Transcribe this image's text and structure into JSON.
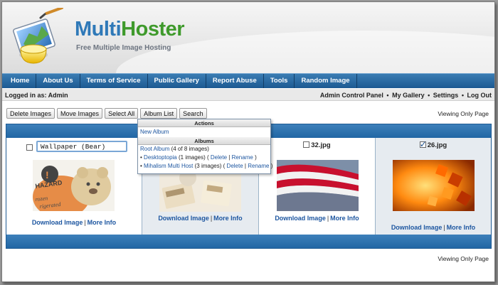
{
  "colors": {
    "brand_blue": "#2f79b8",
    "brand_green": "#3f9a2c",
    "nav_blue": "#1d5a92",
    "link_blue": "#1d56a0"
  },
  "brand": {
    "part1": "Multi",
    "part2": "Hoster",
    "tagline": "Free Multiple Image Hosting",
    "logo_icon": "paint-palette-icon"
  },
  "nav": [
    "Home",
    "About Us",
    "Terms of Service",
    "Public Gallery",
    "Report Abuse",
    "Tools",
    "Random Image"
  ],
  "session": {
    "logged_in": "Logged in as: Admin",
    "links": [
      "Admin Control Panel",
      "My Gallery",
      "Settings",
      "Log Out"
    ],
    "sep": "•"
  },
  "toolbar": [
    "Delete Images",
    "Move Images",
    "Select All",
    "Album List",
    "Search"
  ],
  "viewing": "Viewing Only Page",
  "dropdown": {
    "actions_label": "Actions",
    "new_album": "New Album",
    "albums_label": "Albums",
    "root": {
      "name": "Root Album",
      "count": "(4 of 8 images)"
    },
    "albums": [
      {
        "name": "Desktoptopia",
        "count": "(1 images) (",
        "delete": "Delete",
        "rename": "Rename",
        "close": ")"
      },
      {
        "name": "Mihalism Multi Host",
        "count": "(3 images) (",
        "delete": "Delete",
        "rename": "Rename",
        "close": ")"
      }
    ],
    "bullet": "•",
    "pipe": "|"
  },
  "images": [
    {
      "title": "Wallpaper (Bear)",
      "checked": false,
      "download": "Download Image",
      "info": "More Info"
    },
    {
      "title": "",
      "checked": false,
      "download": "Download Image",
      "info": "More Info"
    },
    {
      "title": "32.jpg",
      "checked": false,
      "download": "Download Image",
      "info": "More Info"
    },
    {
      "title": "26.jpg",
      "checked": true,
      "download": "Download Image",
      "info": "More Info"
    }
  ],
  "pipe": "|"
}
